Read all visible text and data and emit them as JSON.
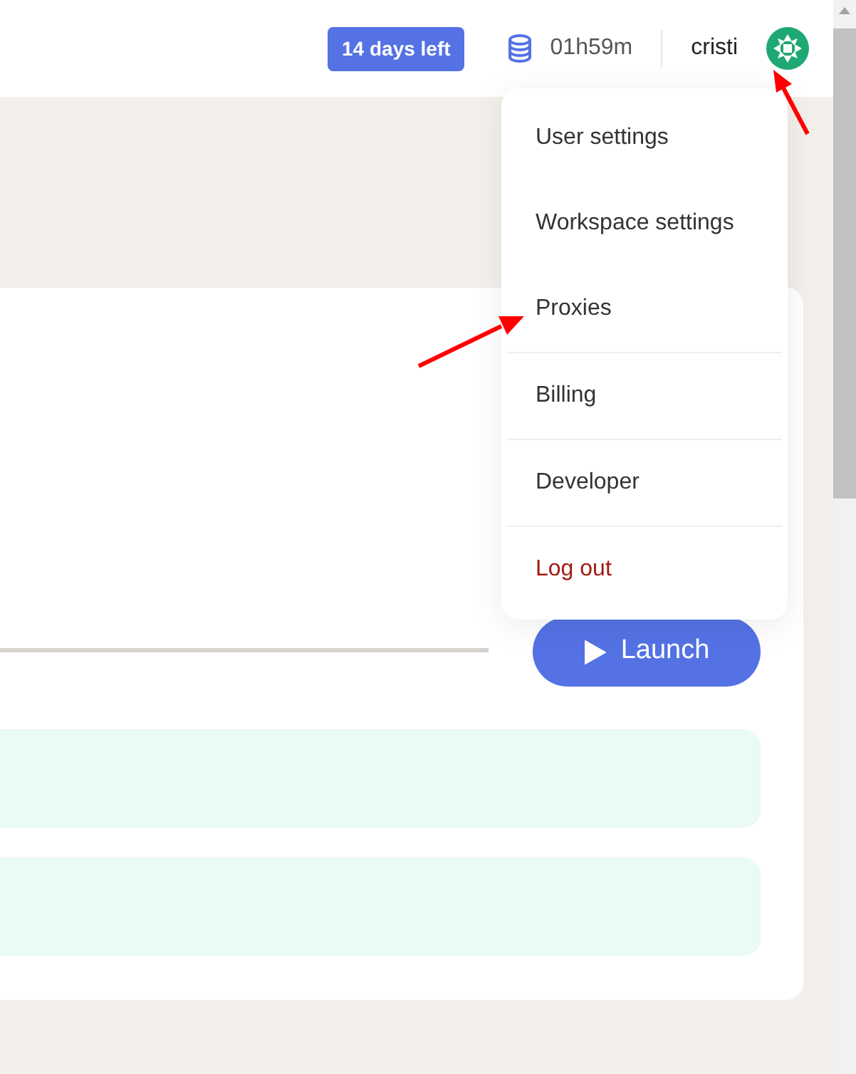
{
  "header": {
    "trial_badge": "14 days left",
    "credits": "01h59m",
    "username": "cristi"
  },
  "user_menu": {
    "items": [
      {
        "label": "User settings",
        "kind": "normal",
        "divider_above": false
      },
      {
        "label": "Workspace settings",
        "kind": "normal",
        "divider_above": false
      },
      {
        "label": "Proxies",
        "kind": "normal",
        "divider_above": false
      },
      {
        "label": "Billing",
        "kind": "normal",
        "divider_above": true
      },
      {
        "label": "Developer",
        "kind": "normal",
        "divider_above": true
      },
      {
        "label": "Log out",
        "kind": "danger",
        "divider_above": true
      }
    ]
  },
  "launch_button": {
    "label": "Launch"
  }
}
